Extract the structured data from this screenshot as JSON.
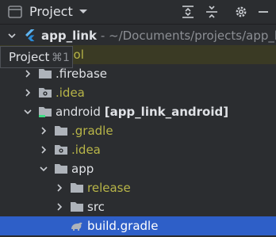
{
  "panel": {
    "title": "Project",
    "title_icon": "project-panel-icon",
    "actions": [
      "expand-all-icon",
      "collapse-all-icon",
      "gear-icon",
      "minimize-icon"
    ]
  },
  "tooltip": {
    "text": "Project",
    "shortcut": "⌘1"
  },
  "tree": {
    "rows": [
      {
        "label": "app_link",
        "suffix": " - ~/Documents/projects/app_lir",
        "icon": "flutter-icon",
        "expanded": true
      },
      {
        "label": "_tool",
        "icon": "folder-icon",
        "expanded": false
      },
      {
        "label": ".firebase",
        "icon": "folder-icon",
        "expanded": false
      },
      {
        "label": ".idea",
        "icon": "idea-folder-icon",
        "expanded": false
      },
      {
        "label": "android",
        "module": "[app_link_android]",
        "icon": "android-module-folder-icon",
        "expanded": true
      },
      {
        "label": ".gradle",
        "icon": "folder-icon",
        "expanded": false
      },
      {
        "label": ".idea",
        "icon": "idea-folder-icon",
        "expanded": false
      },
      {
        "label": "app",
        "icon": "folder-icon",
        "expanded": true
      },
      {
        "label": "release",
        "icon": "folder-icon",
        "expanded": false
      },
      {
        "label": "src",
        "icon": "folder-icon",
        "expanded": false
      },
      {
        "label": "build.gradle",
        "icon": "gradle-file-icon",
        "selected": true
      }
    ]
  }
}
